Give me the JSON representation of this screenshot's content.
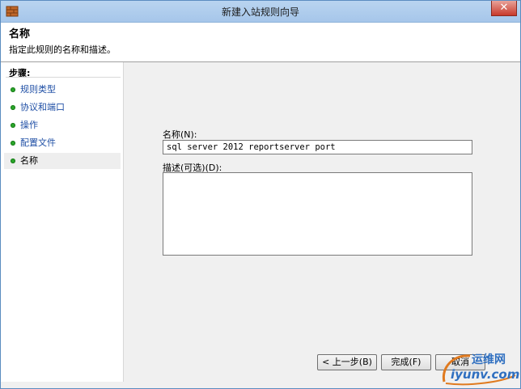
{
  "window": {
    "title": "新建入站规则向导",
    "close_glyph": "✕"
  },
  "header": {
    "title": "名称",
    "subtitle": "指定此规则的名称和描述。"
  },
  "steps": {
    "heading": "步骤:",
    "items": [
      {
        "label": "规则类型"
      },
      {
        "label": "协议和端口"
      },
      {
        "label": "操作"
      },
      {
        "label": "配置文件"
      },
      {
        "label": "名称"
      }
    ],
    "current_index": 4,
    "dot_color": "#2aa62a"
  },
  "form": {
    "name_label": "名称(N):",
    "name_value": "sql server 2012 reportserver port",
    "description_label": "描述(可选)(D):",
    "description_value": ""
  },
  "buttons": {
    "back": "< 上一步(B)",
    "finish": "完成(F)",
    "cancel": "取消"
  },
  "watermark": {
    "top": "运维网",
    "bottom": "iyunv.com"
  }
}
